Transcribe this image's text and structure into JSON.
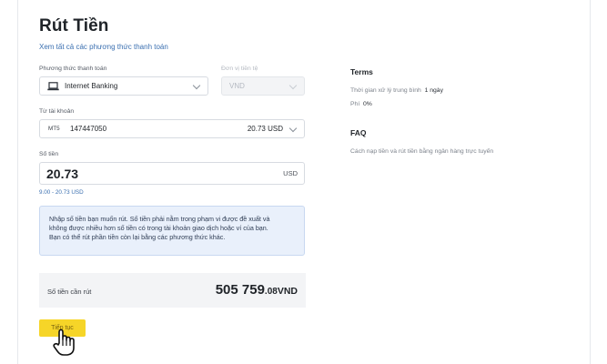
{
  "page": {
    "title": "Rút Tiền",
    "all_methods_link": "Xem tất cả các phương thức thanh toán"
  },
  "form": {
    "method_label": "Phương thức thanh toán",
    "method_value": "Internet Banking",
    "method_icon": "laptop-icon",
    "currency_label": "Đơn vị tiền tệ",
    "currency_value": "VND",
    "from_account_label": "Từ tài khoản",
    "account_platform": "MT5",
    "account_number": "147447050",
    "account_balance": "20.73 USD",
    "amount_label": "Số tiền",
    "amount_value": "20.73",
    "amount_unit": "USD",
    "amount_range": "9.00 - 20.73 USD"
  },
  "info": {
    "lines": [
      "Nhập số tiền bạn muốn rút. Số tiền phải nằm trong phạm vi được đề xuất và",
      "không được nhiều hơn số tiền có trong tài khoản giao dịch hoặc ví của bạn.",
      "Bạn có thể rút phần tiền còn lại bằng các phương thức khác."
    ]
  },
  "total": {
    "label": "Số tiền cần rút",
    "integer": "505 759",
    "decimal": ".08",
    "currency": "VND"
  },
  "actions": {
    "continue_label": "Tiếp tục"
  },
  "sidebar": {
    "terms_title": "Terms",
    "processing_label": "Thời gian xử lý trung bình",
    "processing_value": "1 ngày",
    "fee_label": "Phí",
    "fee_value": "0%",
    "faq_title": "FAQ",
    "faq_link": "Cách nạp tiền và rút tiền bằng ngân hàng trực tuyến"
  },
  "colors": {
    "accent_yellow": "#f6d528",
    "link_blue": "#3a6fb0",
    "info_bg": "#e9f0fb"
  }
}
